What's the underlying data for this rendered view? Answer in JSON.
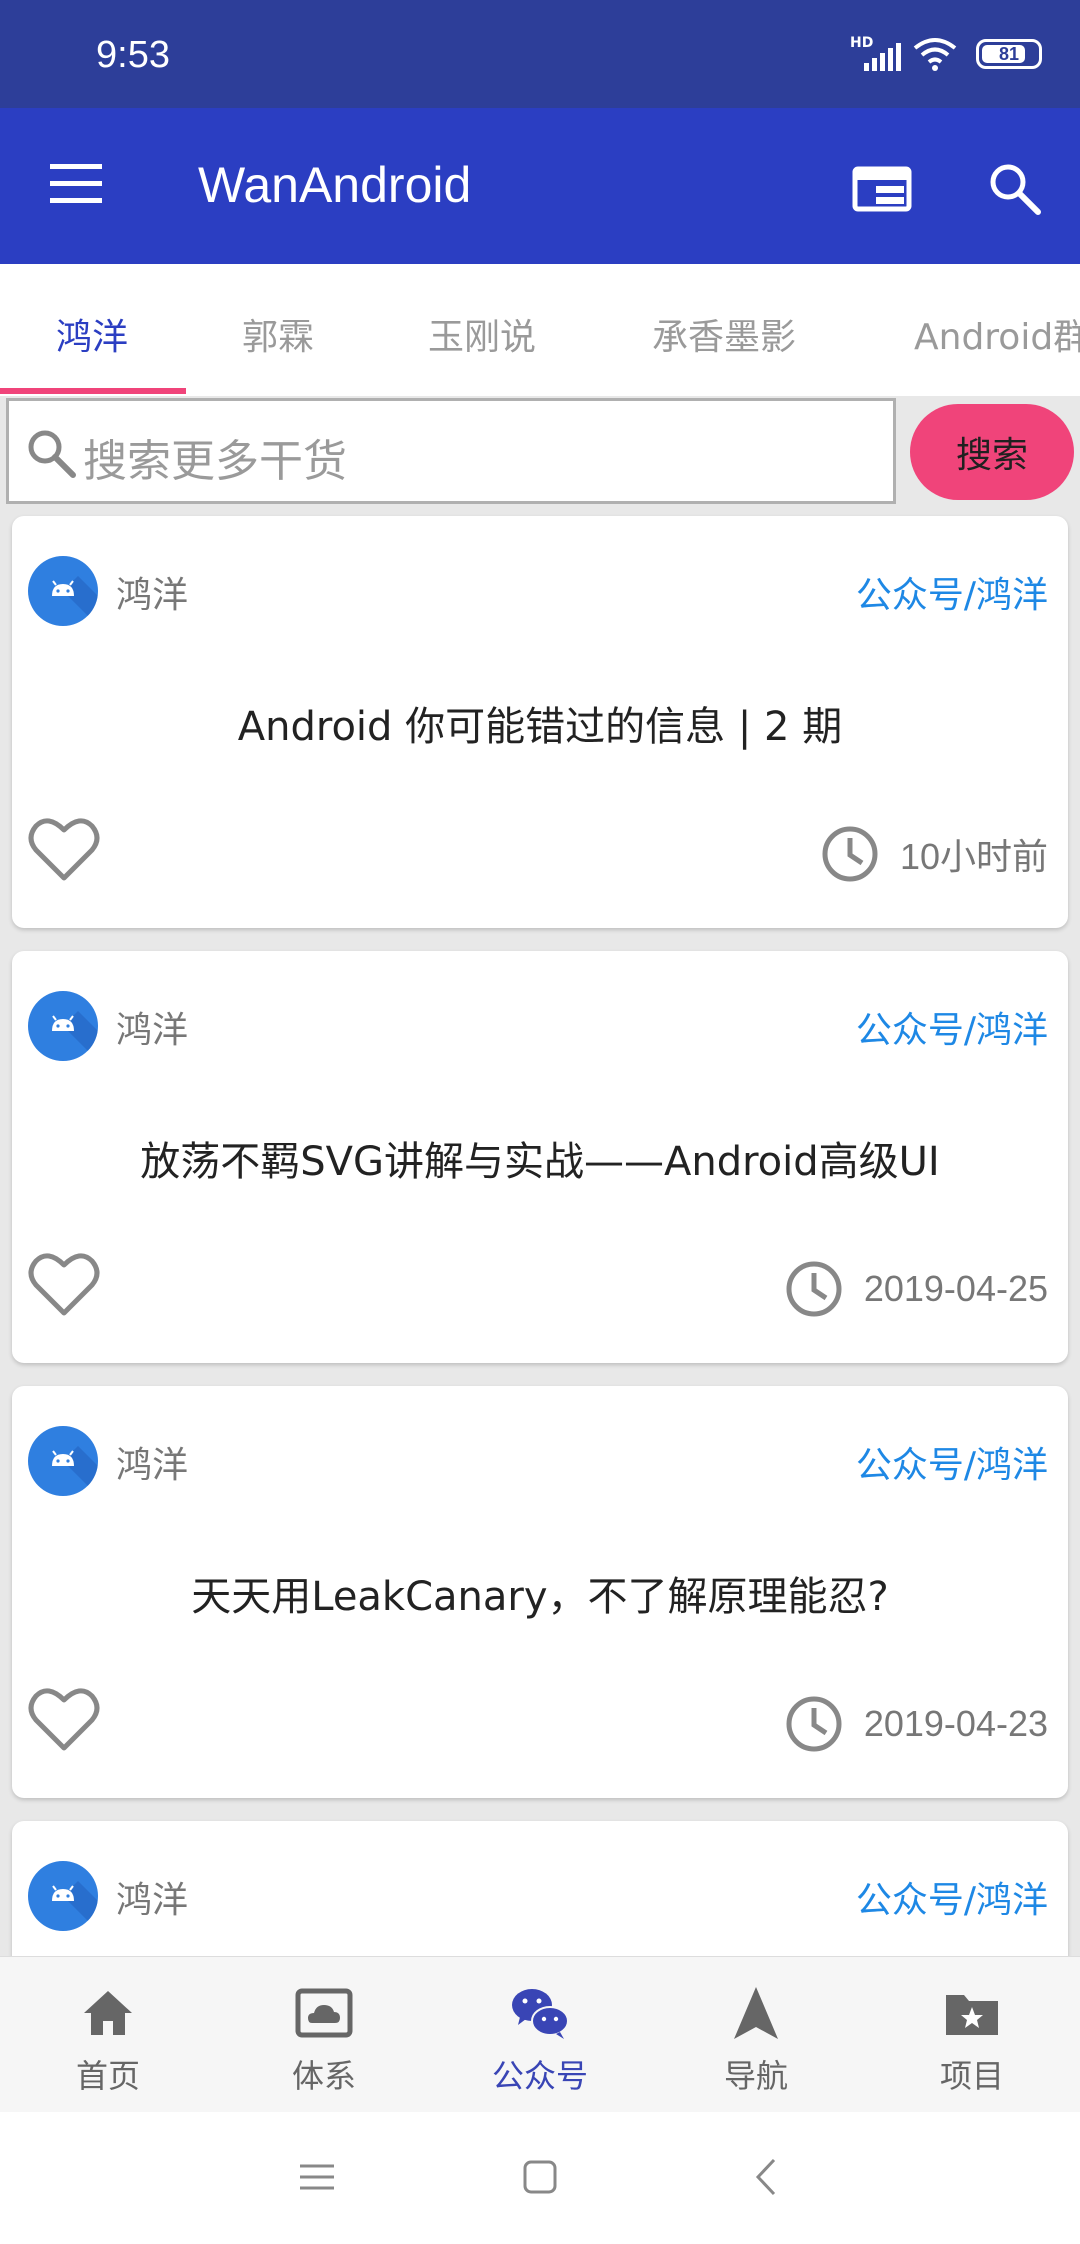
{
  "status_bar": {
    "time": "9:53",
    "network_label": "HD",
    "battery": "81"
  },
  "app_bar": {
    "title": "WanAndroid"
  },
  "tabs": [
    {
      "label": "鸿洋"
    },
    {
      "label": "郭霖"
    },
    {
      "label": "玉刚说"
    },
    {
      "label": "承香墨影"
    },
    {
      "label": "Android群"
    }
  ],
  "search": {
    "placeholder": "搜索更多干货",
    "button_label": "搜索"
  },
  "articles": [
    {
      "author": "鸿洋",
      "chapter": "公众号/鸿洋",
      "title": "Android 你可能错过的信息 | 2 期",
      "time": "10小时前"
    },
    {
      "author": "鸿洋",
      "chapter": "公众号/鸿洋",
      "title": "放荡不羁SVG讲解与实战——Android高级UI",
      "time": "2019-04-25"
    },
    {
      "author": "鸿洋",
      "chapter": "公众号/鸿洋",
      "title": "天天用LeakCanary，不了解原理能忍?",
      "time": "2019-04-23"
    },
    {
      "author": "鸿洋",
      "chapter": "公众号/鸿洋",
      "title": "",
      "time": ""
    }
  ],
  "bottom_nav": [
    {
      "label": "首页",
      "icon": "home-icon"
    },
    {
      "label": "体系",
      "icon": "system-icon"
    },
    {
      "label": "公众号",
      "icon": "wechat-icon"
    },
    {
      "label": "导航",
      "icon": "navigation-icon"
    },
    {
      "label": "项目",
      "icon": "project-folder-icon"
    }
  ],
  "colors": {
    "status_bar": "#2d3e99",
    "primary": "#2b3ec2",
    "accent": "#f0447a",
    "chapter_link": "#1e88e5",
    "active_nav": "#3945b5"
  }
}
